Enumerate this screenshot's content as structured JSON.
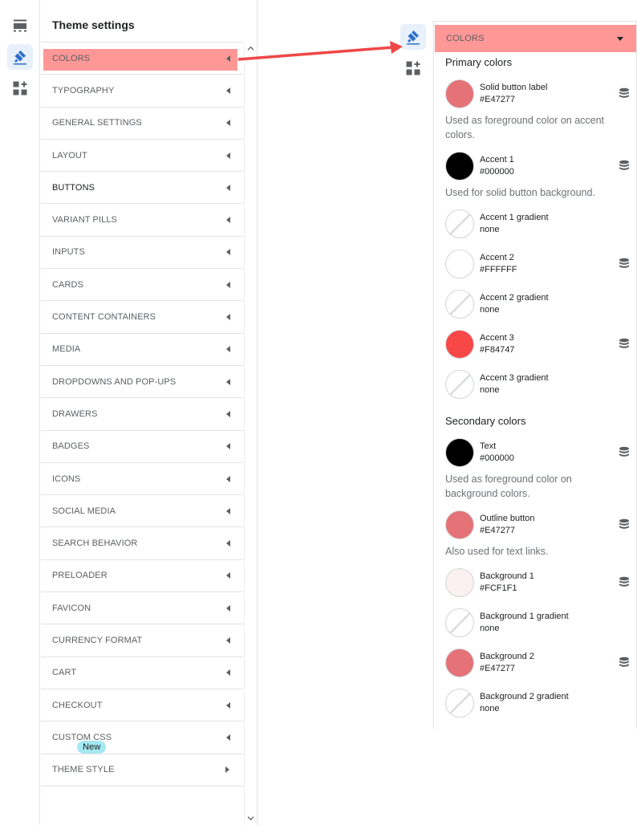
{
  "rail": {
    "icons": [
      "sections-icon",
      "theme-brush-icon",
      "app-blocks-icon"
    ]
  },
  "panel": {
    "title": "Theme settings",
    "items": [
      {
        "label": "COLORS",
        "caret": "left",
        "highlight": true
      },
      {
        "label": "TYPOGRAPHY",
        "caret": "left"
      },
      {
        "label": "GENERAL SETTINGS",
        "caret": "left"
      },
      {
        "label": "LAYOUT",
        "caret": "left"
      },
      {
        "label": "BUTTONS",
        "caret": "left",
        "bold": true
      },
      {
        "label": "VARIANT PILLS",
        "caret": "left"
      },
      {
        "label": "INPUTS",
        "caret": "left"
      },
      {
        "label": "CARDS",
        "caret": "left"
      },
      {
        "label": "CONTENT CONTAINERS",
        "caret": "left"
      },
      {
        "label": "MEDIA",
        "caret": "left"
      },
      {
        "label": "DROPDOWNS AND POP-UPS",
        "caret": "left"
      },
      {
        "label": "DRAWERS",
        "caret": "left"
      },
      {
        "label": "BADGES",
        "caret": "left"
      },
      {
        "label": "ICONS",
        "caret": "left"
      },
      {
        "label": "SOCIAL MEDIA",
        "caret": "left"
      },
      {
        "label": "SEARCH BEHAVIOR",
        "caret": "left"
      },
      {
        "label": "PRELOADER",
        "caret": "left"
      },
      {
        "label": "FAVICON",
        "caret": "left"
      },
      {
        "label": "CURRENCY FORMAT",
        "caret": "left"
      },
      {
        "label": "CART",
        "caret": "left"
      },
      {
        "label": "CHECKOUT",
        "caret": "left"
      },
      {
        "label": "CUSTOM CSS",
        "caret": "left",
        "badge": "New"
      },
      {
        "label": "THEME STYLE",
        "caret": "right"
      }
    ]
  },
  "colors_panel": {
    "header": "COLORS",
    "primary_title": "Primary colors",
    "secondary_title": "Secondary colors",
    "primary": [
      {
        "label": "Solid button label",
        "value": "#E47277",
        "color": "#E47277",
        "db": true,
        "help": "Used as foreground color on accent colors."
      },
      {
        "label": "Accent 1",
        "value": "#000000",
        "color": "#000000",
        "db": true,
        "help": "Used for solid button background."
      },
      {
        "label": "Accent 1 gradient",
        "value": "none",
        "color": "none",
        "db": false
      },
      {
        "label": "Accent 2",
        "value": "#FFFFFF",
        "color": "#FFFFFF",
        "db": true
      },
      {
        "label": "Accent 2 gradient",
        "value": "none",
        "color": "none",
        "db": false
      },
      {
        "label": "Accent 3",
        "value": "#F84747",
        "color": "#F84747",
        "db": true
      },
      {
        "label": "Accent 3 gradient",
        "value": "none",
        "color": "none",
        "db": false
      }
    ],
    "secondary": [
      {
        "label": "Text",
        "value": "#000000",
        "color": "#000000",
        "db": true,
        "help": "Used as foreground color on background colors."
      },
      {
        "label": "Outline button",
        "value": "#E47277",
        "color": "#E47277",
        "db": true,
        "help": "Also used for text links."
      },
      {
        "label": "Background 1",
        "value": "#FCF1F1",
        "color": "#FCF1F1",
        "db": true
      },
      {
        "label": "Background 1 gradient",
        "value": "none",
        "color": "none",
        "db": false
      },
      {
        "label": "Background 2",
        "value": "#E47277",
        "color": "#E47277",
        "db": true
      },
      {
        "label": "Background 2 gradient",
        "value": "none",
        "color": "none",
        "db": false
      }
    ]
  },
  "colors": {
    "accent_blue": "#2c6ecb",
    "highlight": "#ff9797",
    "arrow": "#f04747",
    "badge": "#a4e8f2"
  }
}
